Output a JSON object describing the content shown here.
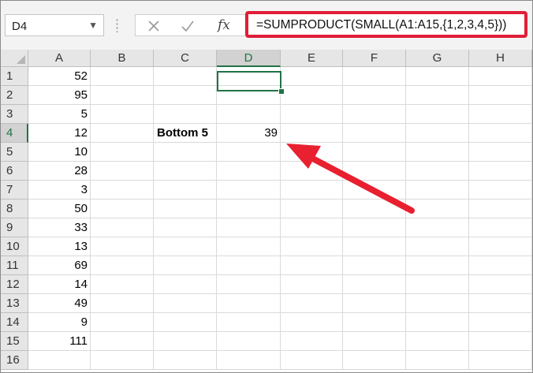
{
  "formula_bar": {
    "name_box": "D4",
    "fx_label": "fx",
    "formula": "=SUMPRODUCT(SMALL(A1:A15,{1,2,3,4,5}))"
  },
  "columns": [
    "A",
    "B",
    "C",
    "D",
    "E",
    "F",
    "G",
    "H"
  ],
  "selected_column": "D",
  "selected_row": 4,
  "rows": [
    {
      "num": "1",
      "A": "52",
      "C": "",
      "D": ""
    },
    {
      "num": "2",
      "A": "95",
      "C": "",
      "D": ""
    },
    {
      "num": "3",
      "A": "5",
      "C": "",
      "D": ""
    },
    {
      "num": "4",
      "A": "12",
      "C": "Bottom 5",
      "D": "39"
    },
    {
      "num": "5",
      "A": "10",
      "C": "",
      "D": ""
    },
    {
      "num": "6",
      "A": "28",
      "C": "",
      "D": ""
    },
    {
      "num": "7",
      "A": "3",
      "C": "",
      "D": ""
    },
    {
      "num": "8",
      "A": "50",
      "C": "",
      "D": ""
    },
    {
      "num": "9",
      "A": "33",
      "C": "",
      "D": ""
    },
    {
      "num": "10",
      "A": "13",
      "C": "",
      "D": ""
    },
    {
      "num": "11",
      "A": "69",
      "C": "",
      "D": ""
    },
    {
      "num": "12",
      "A": "14",
      "C": "",
      "D": ""
    },
    {
      "num": "13",
      "A": "49",
      "C": "",
      "D": ""
    },
    {
      "num": "14",
      "A": "9",
      "C": "",
      "D": ""
    },
    {
      "num": "15",
      "A": "111",
      "C": "",
      "D": ""
    },
    {
      "num": "16",
      "A": "",
      "C": "",
      "D": ""
    }
  ],
  "colors": {
    "excel_green": "#217346",
    "highlight_red": "#e01e37"
  },
  "icons": {
    "name_box_dropdown": "chevron-down-icon",
    "cancel": "close-icon",
    "enter": "check-icon",
    "insert_function": "fx-icon",
    "annotation": "arrow-icon"
  }
}
